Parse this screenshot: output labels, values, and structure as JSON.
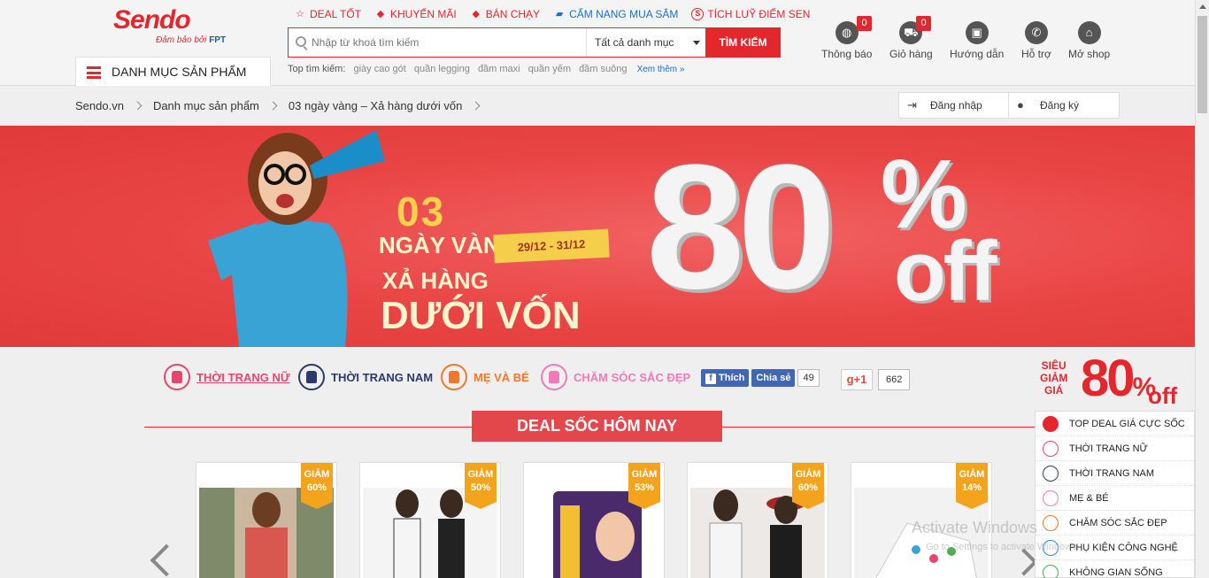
{
  "header": {
    "logo": "Sendo",
    "logo_tagline": "Đảm bảo bởi",
    "logo_partner": "FPT",
    "category_menu_label": "DANH MỤC SẢN PHẨM",
    "top_links": [
      {
        "label": "DEAL TỐT",
        "icon": "star-icon"
      },
      {
        "label": "KHUYẾN MÃI",
        "icon": "tag-icon"
      },
      {
        "label": "BÁN CHẠY",
        "icon": "tag-icon"
      },
      {
        "label": "CẨM NANG MUA SẮM",
        "icon": "book-icon"
      },
      {
        "label": "TÍCH LUỸ ĐIỂM SEN",
        "icon": "sen-coin-icon",
        "glyph": "S"
      }
    ],
    "search": {
      "placeholder": "Nhập từ khoá tìm kiếm",
      "category": "Tất cả danh mục",
      "button": "TÌM KIẾM"
    },
    "top_search": {
      "label": "Top tìm kiếm:",
      "keywords": [
        "giày cao gót",
        "quần legging",
        "đầm maxi",
        "quần yếm",
        "đầm suông"
      ],
      "more": "Xem thêm »"
    },
    "icons": [
      {
        "label": "Thông báo",
        "badge": "0",
        "icon": "globe-icon"
      },
      {
        "label": "Giỏ hàng",
        "badge": "0",
        "icon": "cart-icon"
      },
      {
        "label": "Hướng dẫn",
        "icon": "guide-icon"
      },
      {
        "label": "Hỗ trợ",
        "icon": "phone-icon"
      },
      {
        "label": "Mở shop",
        "icon": "shop-icon"
      }
    ]
  },
  "breadcrumb": [
    "Sendo.vn",
    "Danh mục sản phẩm",
    "03 ngày vàng – Xả hàng dưới vốn"
  ],
  "auth": {
    "login": "Đăng nhập",
    "register": "Đăng ký"
  },
  "banner": {
    "line_03": "03",
    "line_ngay_vang": "NGÀY VÀNG",
    "dates": "29/12 - 31/12",
    "line_xa_hang": "XẢ HÀNG",
    "line_duoi_von": "DƯỚI VỐN",
    "discount": "80",
    "percent": "%",
    "off": "off"
  },
  "categories": [
    {
      "label": "THỜI TRANG NỮ",
      "color": "#e4476b"
    },
    {
      "label": "THỜI TRANG NAM",
      "color": "#2b3a6b"
    },
    {
      "label": "MẸ VÀ BÉ",
      "color": "#f0782a"
    },
    {
      "label": "CHĂM SÓC SẮC ĐẸP",
      "color": "#f07ab8"
    }
  ],
  "social": {
    "fb_like": "Thích",
    "fb_share": "Chia sẻ",
    "fb_count": "49",
    "gplus": "g+1",
    "gplus_count": "662"
  },
  "deal_title": "DEAL SỐC HÔM NAY",
  "products": [
    {
      "tag_label": "GIẢM",
      "discount": "60%"
    },
    {
      "tag_label": "GIẢM",
      "discount": "50%"
    },
    {
      "tag_label": "GIẢM",
      "discount": "53%"
    },
    {
      "tag_label": "GIẢM",
      "discount": "60%"
    },
    {
      "tag_label": "GIẢM",
      "discount": "14%"
    }
  ],
  "side_promo": {
    "sieu": "SIÊU",
    "giam": "GIẢM",
    "gia": "GIÁ",
    "discount": "80",
    "percent": "%",
    "off": "off",
    "items": [
      {
        "label": "TOP DEAL GIÁ CỰC SỐC",
        "color": "#e4262d"
      },
      {
        "label": "THỜI TRANG NỮ",
        "color": "#e4476b"
      },
      {
        "label": "THỜI TRANG NAM",
        "color": "#2b3a6b"
      },
      {
        "label": "MẸ & BÉ",
        "color": "#f07ab8"
      },
      {
        "label": "CHĂM SÓC SẮC ĐẸP",
        "color": "#f0782a"
      },
      {
        "label": "PHỤ KIỆN CÔNG NGHỆ",
        "color": "#2a8fd6"
      },
      {
        "label": "KHÔNG GIAN SỐNG",
        "color": "#4caf50"
      }
    ]
  },
  "watermark": {
    "title": "Activate Windows",
    "subtitle": "Go to Settings to activate Windows."
  },
  "colors": {
    "brand": "#e4262d",
    "link_blue": "#1a6fc1",
    "tag_orange": "#f4a41c"
  }
}
